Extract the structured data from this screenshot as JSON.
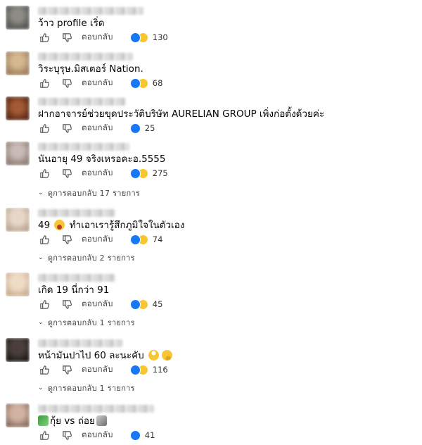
{
  "actions": {
    "reply_label": "ตอบกลับ"
  },
  "reply_prefix": "ดูการตอบกลับ",
  "reply_suffix": "รายการ",
  "comments": [
    {
      "text": "ว้าว profile เริ่ด",
      "reactions": [
        "like",
        "haha"
      ],
      "count": "130",
      "replies": null,
      "avatar": "#6b6a66"
    },
    {
      "text": "วิระบุรุษ.มิสเตอร์ Nation.",
      "reactions": [
        "like",
        "haha"
      ],
      "count": "68",
      "replies": null,
      "avatar": "#c2a27a"
    },
    {
      "text": "ฝากอาจารย์ช่วยขุดประวัติบริษัท AURELIAN GROUP เพิ่งก่อตั้งด้วยค่ะ",
      "reactions": [
        "like"
      ],
      "count": "25",
      "replies": null,
      "avatar": "#7a3b22"
    },
    {
      "text": "นันอายุ 49 จริงเหรอคะอ.5555",
      "reactions": [
        "like",
        "haha"
      ],
      "count": "275",
      "replies": "17",
      "avatar": "#b7aaa4"
    },
    {
      "text_before": "49",
      "emoji": "haha",
      "text_after": "ทำเอาเรารู้สึกภูมิใจในตัวเอง",
      "reactions": [
        "like",
        "haha"
      ],
      "count": "74",
      "replies": "2",
      "avatar": "#d9c7b4"
    },
    {
      "text": "เกิด 19 นี่กว่า 91",
      "reactions": [
        "like",
        "haha"
      ],
      "count": "45",
      "replies": "1",
      "avatar": "#e0c8b0"
    },
    {
      "text_before": "หน้ามันปาไป 60 ละนะคับ",
      "emoji2": [
        "rolling-eyes",
        "thinking"
      ],
      "reactions": [
        "like",
        "haha"
      ],
      "count": "116",
      "replies": "1",
      "avatar": "#2b2624"
    },
    {
      "emoji_lead": "dragon",
      "text": "กุ้ย vs ถ่อย",
      "emoji_tail": "sheep",
      "reactions": [
        "like"
      ],
      "count": "41",
      "replies": null,
      "avatar": "#b79a8a"
    }
  ],
  "colors": {
    "like": "#1877f2",
    "haha": "#f7c632",
    "text": "#050505",
    "meta": "#444444"
  }
}
